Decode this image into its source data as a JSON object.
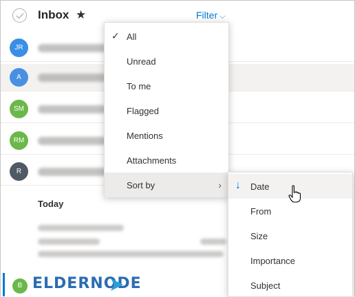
{
  "header": {
    "title": "Inbox",
    "filter_label": "Filter",
    "star": "★"
  },
  "messages": [
    {
      "initials": "JR",
      "color": "#3a8ee6"
    },
    {
      "initials": "A",
      "color": "#4a90e2"
    },
    {
      "initials": "SM",
      "color": "#6bb84a"
    },
    {
      "initials": "RM",
      "color": "#6bb84a"
    },
    {
      "initials": "R",
      "color": "#505a64"
    }
  ],
  "section_today": "Today",
  "bottom_avatar": {
    "initials": "B",
    "color": "#6bb84a"
  },
  "watermark": "ELDERNODE",
  "filter_menu": {
    "items": [
      {
        "label": "All",
        "checked": true
      },
      {
        "label": "Unread"
      },
      {
        "label": "To me"
      },
      {
        "label": "Flagged"
      },
      {
        "label": "Mentions"
      },
      {
        "label": "Attachments"
      },
      {
        "label": "Sort by",
        "has_submenu": true
      }
    ]
  },
  "sort_menu": {
    "items": [
      {
        "label": "Date",
        "selected": true
      },
      {
        "label": "From"
      },
      {
        "label": "Size"
      },
      {
        "label": "Importance"
      },
      {
        "label": "Subject"
      }
    ]
  },
  "colors": {
    "accent": "#0078d4"
  }
}
